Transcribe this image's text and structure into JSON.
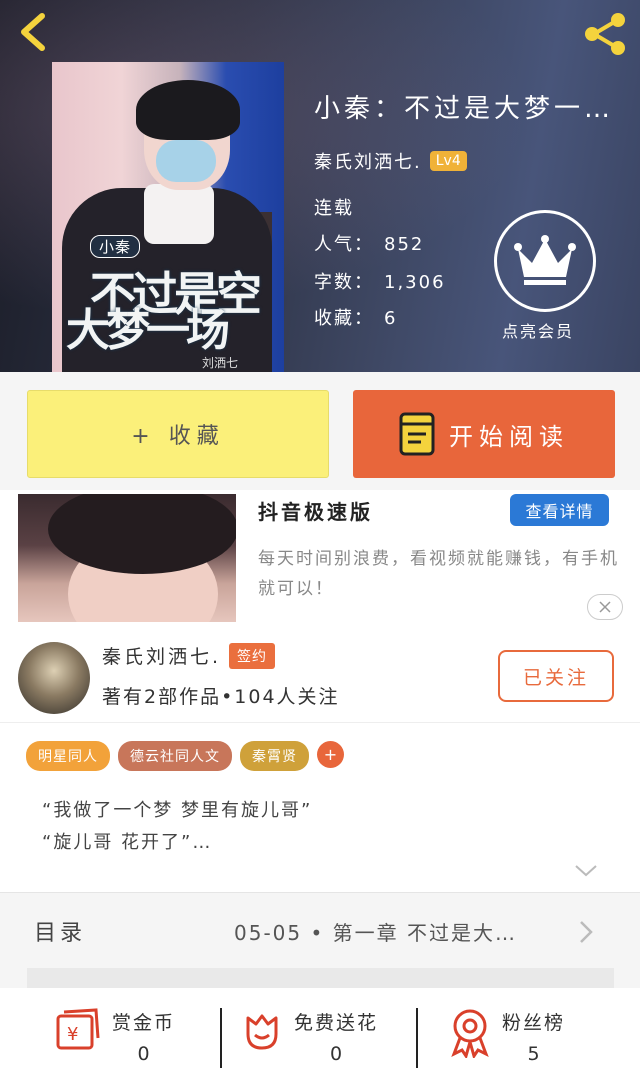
{
  "header": {
    "book_title": "小秦：不过是大梦一…",
    "author": "秦氏刘洒七.",
    "level": "Lv4",
    "status": "连载",
    "popularity_label": "人气：",
    "popularity": "852",
    "words_label": "字数：",
    "words": "1,306",
    "favorites_label": "收藏：",
    "favorites": "6",
    "vip_label": "点亮会员"
  },
  "cover": {
    "tag": "小秦",
    "title_line1": "不过是空",
    "title_line2": "大梦一场",
    "signature": "刘洒七"
  },
  "actions": {
    "collect_label": "+ 收藏",
    "read_label": "开始阅读"
  },
  "ad": {
    "title": "抖音极速版",
    "detail_label": "查看详情",
    "desc": "每天时间别浪费，看视频就能赚钱，有手机就可以！"
  },
  "author_row": {
    "name": "秦氏刘洒七.",
    "badge": "签约",
    "stats": "著有2部作品•104人关注",
    "follow_label": "已关注"
  },
  "tags": [
    {
      "label": "明星同人",
      "color": "#f2a23a"
    },
    {
      "label": "德云社同人文",
      "color": "#c8765a"
    },
    {
      "label": "秦霄贤",
      "color": "#cfa13a"
    }
  ],
  "intro": {
    "line1": "“我做了一个梦 梦里有旋儿哥”",
    "line2": "“旋儿哥 花开了”…"
  },
  "catalog": {
    "label": "目录",
    "latest": "05-05 • 第一章 不过是大…"
  },
  "bottom": {
    "coins_label": "赏金币",
    "coins": "0",
    "flower_label": "免费送花",
    "flower": "0",
    "fans_label": "粉丝榜",
    "fans": "5"
  },
  "colors": {
    "accent": "#e8663b",
    "collect": "#fbf07a",
    "icon_red": "#d9402b",
    "back_yellow": "#f4d33d"
  }
}
